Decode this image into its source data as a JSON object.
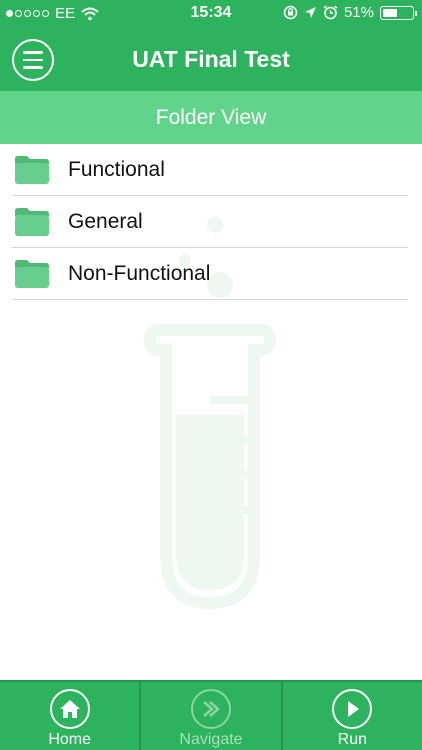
{
  "status_bar": {
    "carrier": "EE",
    "time": "15:34",
    "battery": "51%",
    "battery_level": 0.51,
    "signal_bars_filled": 1,
    "signal_bars_total": 5
  },
  "header": {
    "title": "UAT Final Test",
    "menu_icon": "hamburger-menu-icon"
  },
  "subheader": {
    "title": "Folder View"
  },
  "folders": [
    {
      "label": "Functional",
      "icon": "folder-icon"
    },
    {
      "label": "General",
      "icon": "folder-icon"
    },
    {
      "label": "Non-Functional",
      "icon": "folder-icon"
    }
  ],
  "tabs": [
    {
      "label": "Home",
      "icon": "home-icon",
      "enabled": true
    },
    {
      "label": "Navigate",
      "icon": "navigate-icon",
      "enabled": false
    },
    {
      "label": "Run",
      "icon": "play-icon",
      "enabled": true
    }
  ],
  "colors": {
    "primary": "#2db35d",
    "secondary": "#5fd48a",
    "folder": "#5fc487",
    "watermark": "#eef8f1"
  }
}
